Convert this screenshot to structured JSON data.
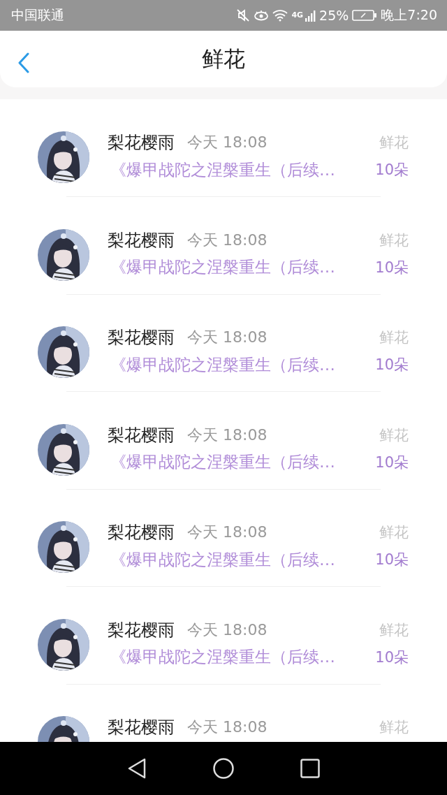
{
  "status_bar": {
    "carrier": "中国联通",
    "network": "4G",
    "battery": "25%",
    "time": "晚上7:20"
  },
  "header": {
    "title": "鲜花"
  },
  "gifts": [
    {
      "sender": "梨花樱雨",
      "time": "今天 18:08",
      "gift": "鲜花",
      "title": "《爆甲战陀之涅槃重生（后续…",
      "count": "10朵"
    },
    {
      "sender": "梨花樱雨",
      "time": "今天 18:08",
      "gift": "鲜花",
      "title": "《爆甲战陀之涅槃重生（后续…",
      "count": "10朵"
    },
    {
      "sender": "梨花樱雨",
      "time": "今天 18:08",
      "gift": "鲜花",
      "title": "《爆甲战陀之涅槃重生（后续…",
      "count": "10朵"
    },
    {
      "sender": "梨花樱雨",
      "time": "今天 18:08",
      "gift": "鲜花",
      "title": "《爆甲战陀之涅槃重生（后续…",
      "count": "10朵"
    },
    {
      "sender": "梨花樱雨",
      "time": "今天 18:08",
      "gift": "鲜花",
      "title": "《爆甲战陀之涅槃重生（后续…",
      "count": "10朵"
    },
    {
      "sender": "梨花樱雨",
      "time": "今天 18:08",
      "gift": "鲜花",
      "title": "《爆甲战陀之涅槃重生（后续…",
      "count": "10朵"
    },
    {
      "sender": "梨花樱雨",
      "time": "今天 18:08",
      "gift": "鲜花"
    }
  ]
}
